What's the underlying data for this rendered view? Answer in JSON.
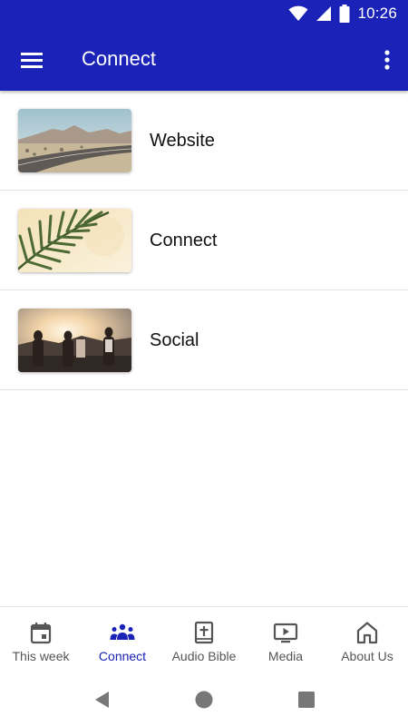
{
  "status_bar": {
    "time": "10:26",
    "icons": [
      "wifi-icon",
      "signal-icon",
      "battery-icon"
    ]
  },
  "app_bar": {
    "title": "Connect",
    "menu_icon": "hamburger-menu-icon",
    "more_icon": "more-vert-icon"
  },
  "list": {
    "items": [
      {
        "label": "Website",
        "thumbnail": "desert-road"
      },
      {
        "label": "Connect",
        "thumbnail": "palm-leaf"
      },
      {
        "label": "Social",
        "thumbnail": "people-sunset"
      }
    ]
  },
  "bottom_nav": {
    "items": [
      {
        "label": "This week",
        "icon": "calendar-icon"
      },
      {
        "label": "Connect",
        "icon": "people-group-icon",
        "active": true
      },
      {
        "label": "Audio Bible",
        "icon": "bible-icon"
      },
      {
        "label": "Media",
        "icon": "video-icon"
      },
      {
        "label": "About Us",
        "icon": "home-icon"
      }
    ]
  },
  "colors": {
    "primary": "#1a22b8",
    "inactive": "#555555",
    "divider": "#e3e3e3"
  }
}
